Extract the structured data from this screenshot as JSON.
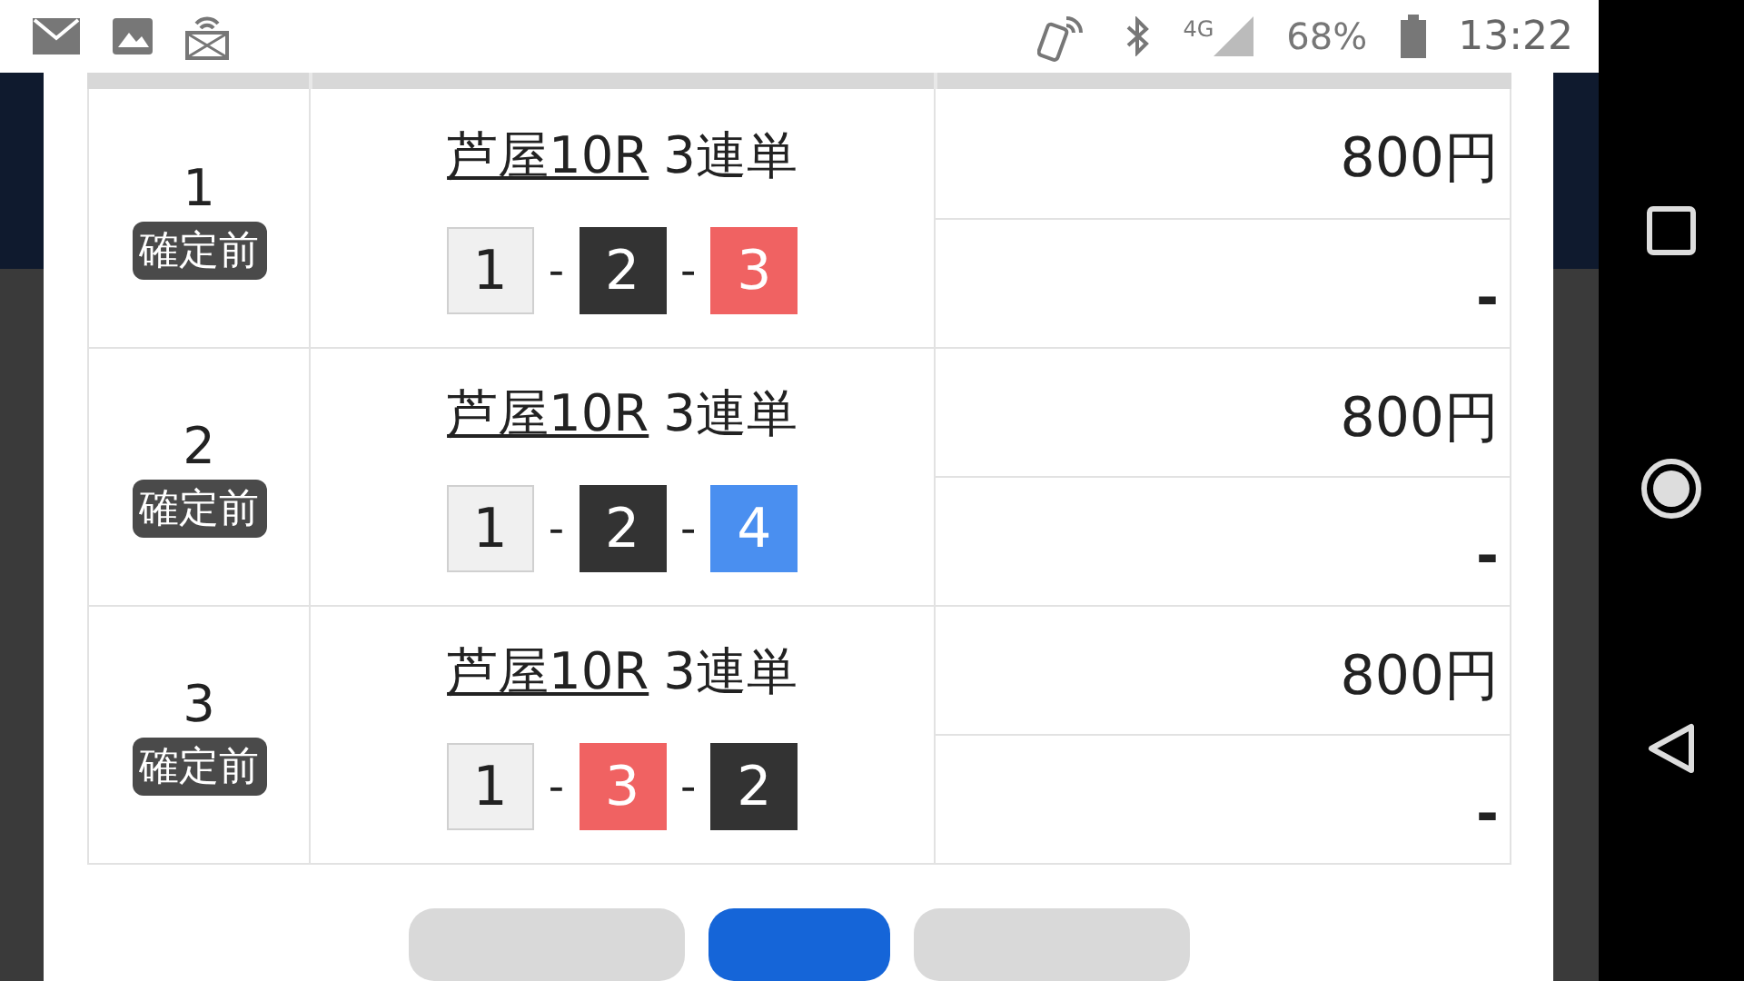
{
  "status_bar": {
    "network": "4G",
    "battery": "68%",
    "time": "13:22"
  },
  "bets": [
    {
      "number": "1",
      "status": "確定前",
      "title": "芦屋10R",
      "bet_type": "3連単",
      "separator": "-",
      "combination": [
        {
          "digit": "1",
          "color": "#f0f0f0"
        },
        {
          "digit": "2",
          "color": "#333333"
        },
        {
          "digit": "3",
          "color": "#f06262"
        }
      ],
      "amount": "800円",
      "payout": "-"
    },
    {
      "number": "2",
      "status": "確定前",
      "title": "芦屋10R",
      "bet_type": "3連単",
      "separator": "-",
      "combination": [
        {
          "digit": "1",
          "color": "#f0f0f0"
        },
        {
          "digit": "2",
          "color": "#333333"
        },
        {
          "digit": "4",
          "color": "#4a8ff0"
        }
      ],
      "amount": "800円",
      "payout": "-"
    },
    {
      "number": "3",
      "status": "確定前",
      "title": "芦屋10R",
      "bet_type": "3連単",
      "separator": "-",
      "combination": [
        {
          "digit": "1",
          "color": "#f0f0f0"
        },
        {
          "digit": "3",
          "color": "#f06262"
        },
        {
          "digit": "2",
          "color": "#333333"
        }
      ],
      "amount": "800円",
      "payout": "-"
    }
  ],
  "footer_buttons": [
    {
      "kind": "secondary"
    },
    {
      "kind": "primary"
    },
    {
      "kind": "secondary"
    }
  ]
}
